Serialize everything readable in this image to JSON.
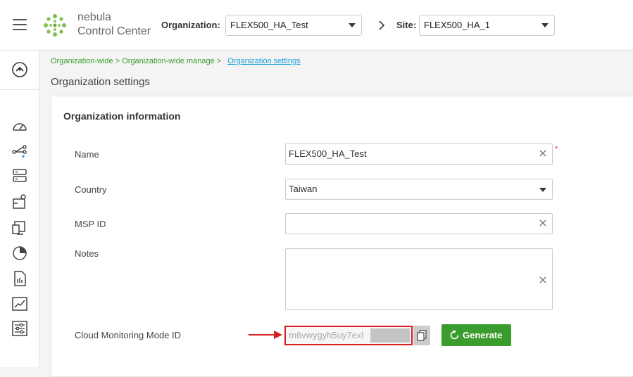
{
  "header": {
    "brand_line1": "nebula",
    "brand_line2": "Control Center",
    "organization_label": "Organization:",
    "organization_value": "FLEX500_HA_Test",
    "site_label": "Site:",
    "site_value": "FLEX500_HA_1"
  },
  "sidebar": {
    "items": [
      {
        "icon": "dashboard-gauge-icon"
      },
      {
        "icon": "topology-icon"
      },
      {
        "icon": "server-list-icon"
      },
      {
        "icon": "map-pin-icon"
      },
      {
        "icon": "devices-icon"
      },
      {
        "icon": "pie-chart-icon"
      },
      {
        "icon": "report-document-icon"
      },
      {
        "icon": "trend-chart-icon"
      },
      {
        "icon": "settings-sliders-icon"
      }
    ]
  },
  "breadcrumb": {
    "item1": "Organization-wide",
    "item2": "Organization-wide manage",
    "separator": ">",
    "current": "Organization settings"
  },
  "page": {
    "title": "Organization settings"
  },
  "card": {
    "title": "Organization information",
    "fields": {
      "name": {
        "label": "Name",
        "value": "FLEX500_HA_Test",
        "required_mark": "*"
      },
      "country": {
        "label": "Country",
        "value": "Taiwan"
      },
      "msp_id": {
        "label": "MSP ID",
        "value": ""
      },
      "notes": {
        "label": "Notes",
        "value": ""
      },
      "cloud_monitoring": {
        "label": "Cloud Monitoring Mode ID",
        "value": "m6vwygyh5uy7exl"
      }
    },
    "generate_label": "Generate"
  },
  "colors": {
    "accent_green": "#3a9c2c",
    "link_blue": "#1a9fd8",
    "highlight_red": "#d81e1e"
  }
}
